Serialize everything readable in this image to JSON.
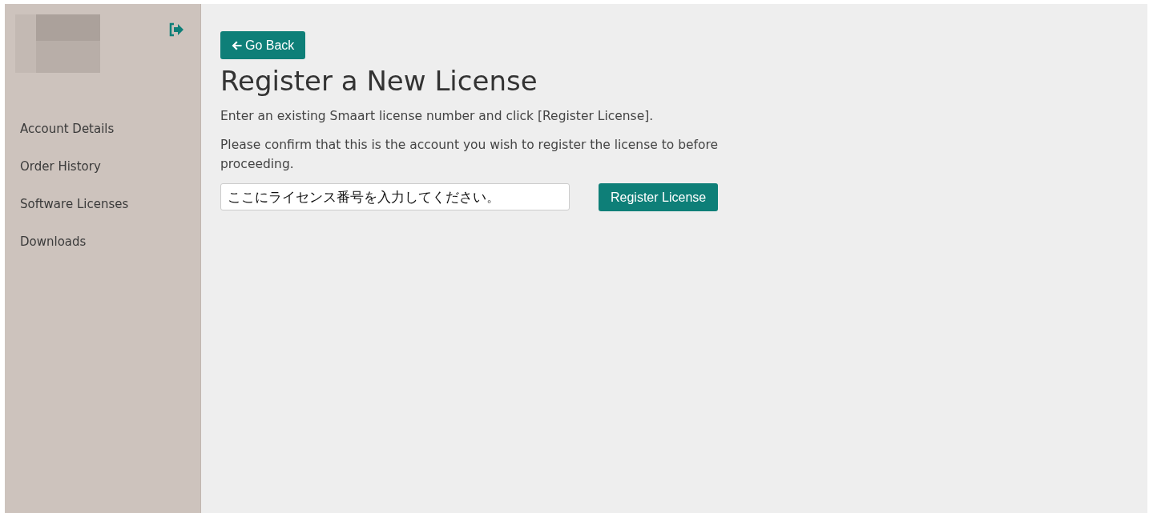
{
  "sidebar": {
    "items": [
      {
        "label": "Account Details"
      },
      {
        "label": "Order History"
      },
      {
        "label": "Software Licenses"
      },
      {
        "label": "Downloads"
      }
    ]
  },
  "main": {
    "back_button": "Go Back",
    "title": "Register a New License",
    "paragraphs": [
      "Enter an existing Smaart license number and click [Register License].",
      "Please confirm that this is the account you wish to register the license to before proceeding."
    ],
    "license_field": {
      "value": "ここにライセンス番号を入力してください。"
    },
    "submit_button": "Register License"
  }
}
